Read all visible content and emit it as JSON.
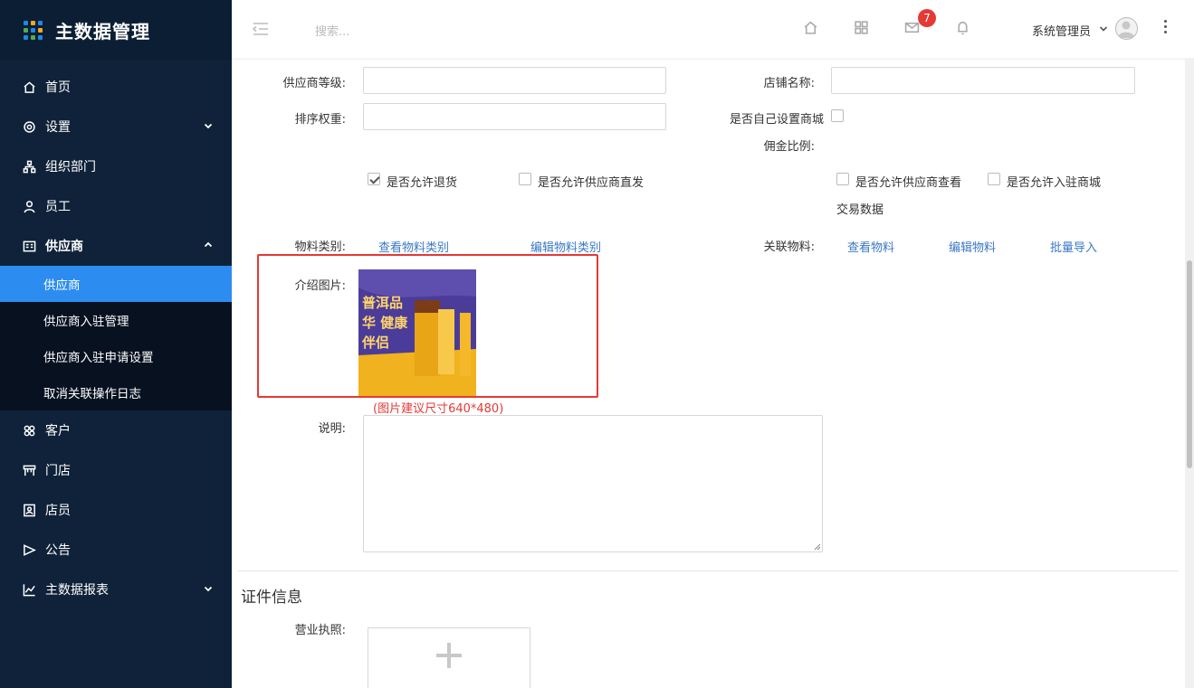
{
  "app": {
    "title": "主数据管理"
  },
  "header": {
    "search_placeholder": "搜索...",
    "mail_badge": "7",
    "user_name": "系统管理员"
  },
  "sidebar": {
    "items": [
      {
        "label": "首页",
        "icon": "home-icon"
      },
      {
        "label": "设置",
        "icon": "gear-icon"
      },
      {
        "label": "组织部门",
        "icon": "org-icon"
      },
      {
        "label": "员工",
        "icon": "user-icon"
      },
      {
        "label": "供应商",
        "icon": "supplier-icon"
      },
      {
        "label": "客户",
        "icon": "customer-icon"
      },
      {
        "label": "门店",
        "icon": "store-icon"
      },
      {
        "label": "店员",
        "icon": "clerk-icon"
      },
      {
        "label": "公告",
        "icon": "notice-icon"
      },
      {
        "label": "主数据报表",
        "icon": "chart-icon"
      }
    ],
    "supplier_sub": [
      {
        "label": "供应商"
      },
      {
        "label": "供应商入驻管理"
      },
      {
        "label": "供应商入驻申请设置"
      },
      {
        "label": "取消关联操作日志"
      }
    ]
  },
  "form": {
    "supplier_level_label": "供应商等级:",
    "shop_name_label": "店铺名称:",
    "sort_weight_label": "排序权重:",
    "self_mall_label": "是否自己设置商城",
    "commission_label": "佣金比例:",
    "allow_return_label": "是否允许退货",
    "allow_direct_ship_label": "是否允许供应商直发",
    "allow_view_trade_label": "是否允许供应商查看",
    "allow_view_trade_label_line2": "交易数据",
    "allow_mall_entry_label": "是否允许入驻商城",
    "material_category_label": "物料类别:",
    "view_material_category": "查看物料类别",
    "edit_material_category": "编辑物料类别",
    "related_material_label": "关联物料:",
    "view_material": "查看物料",
    "edit_material": "编辑物料",
    "batch_import": "批量导入",
    "intro_image_label": "介绍图片:",
    "intro_image_text": "普洱品华 健康伴侣",
    "image_hint": "(图片建议尺寸640*480)",
    "description_label": "说明:",
    "allow_return_checked": true
  },
  "certificates": {
    "section_title": "证件信息",
    "business_license_label": "营业执照:"
  }
}
